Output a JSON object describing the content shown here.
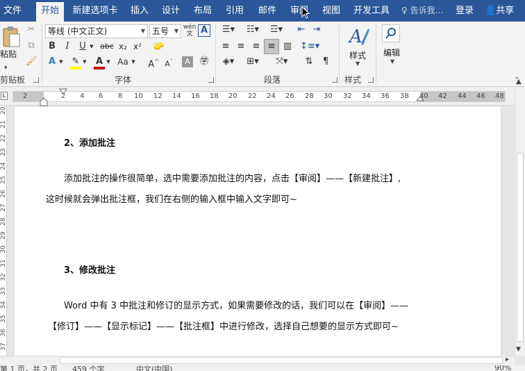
{
  "tabs": [
    "文件",
    "开始",
    "新建选项卡",
    "插入",
    "设计",
    "布局",
    "引用",
    "邮件",
    "审阅",
    "视图",
    "开发工具"
  ],
  "tell_me": "告诉我...",
  "login": "登录",
  "share": "共享",
  "clipboard": {
    "paste": "粘贴",
    "label": "剪贴板"
  },
  "font": {
    "family": "等线 (中文正文)",
    "size": "五号",
    "label": "字体",
    "phonetic": "wén",
    "buttons": [
      "B",
      "I",
      "U",
      "abc",
      "x₂",
      "x²",
      "A",
      "Aa",
      "A",
      "A"
    ]
  },
  "paragraph": {
    "label": "段落"
  },
  "styles": {
    "button": "样式",
    "label": "样式"
  },
  "editing": {
    "button": "编辑"
  },
  "ruler_ticks": [
    "2",
    "2",
    "4",
    "6",
    "8",
    "10",
    "12",
    "14",
    "16",
    "18",
    "20",
    "22",
    "24",
    "26",
    "28",
    "30",
    "32",
    "34",
    "36",
    "38",
    "40",
    "42",
    "44",
    "46",
    "48"
  ],
  "vruler_ticks": [
    "20",
    "21",
    "22",
    "23",
    "24",
    "25",
    "26",
    "27",
    "28",
    "29",
    "30",
    "31",
    "32",
    "33",
    "34",
    "35",
    "36",
    "37"
  ],
  "document": {
    "heading_add": "2、添加批注",
    "para_add_line1": "添加批注的操作很简单，选中需要添加批注的内容，点击【审阅】——【新建批注】,",
    "para_add_line2": "这时候就会弹出批注框，我们在右侧的输入框中输入文字即可~",
    "heading_modify": "3、修改批注",
    "para_modify_line1": "Word 中有 3 中批注和修订的显示方式，如果需要修改的话，我们可以在【审阅】——",
    "para_modify_line2": "【修订】——【显示标记】——【批注框】中进行修改，选择自己想要的显示方式即可~"
  },
  "status": {
    "page": "第 1 页，共 2 页",
    "words": "459 个字",
    "lang": "中文(中国)",
    "zoom": "90%"
  }
}
